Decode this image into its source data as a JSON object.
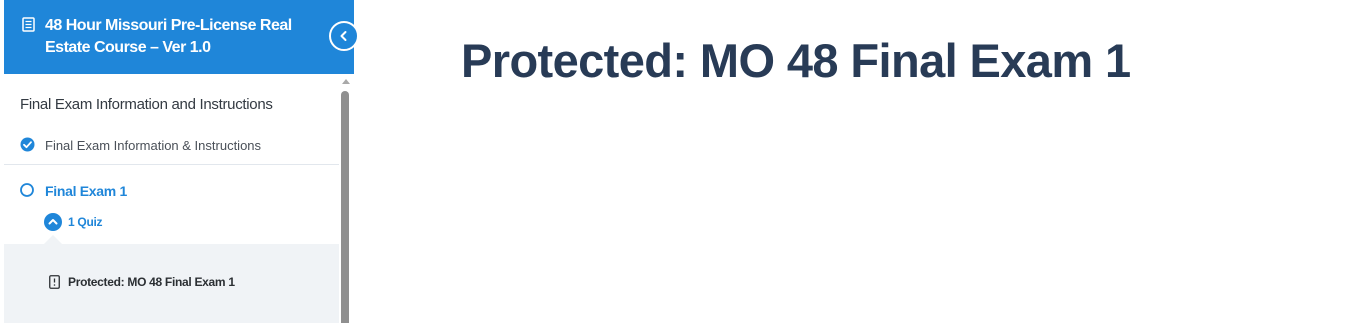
{
  "sidebar": {
    "course_title": "48 Hour Missouri Pre-License Real Estate Course – Ver 1.0",
    "collapse_icon": "chevron-left-icon",
    "section_title": "Final Exam Information and Instructions",
    "lessons": [
      {
        "label": "Final Exam Information & Instructions",
        "status": "completed",
        "icon": "check-circle-icon"
      },
      {
        "label": "Final Exam 1",
        "status": "not-started",
        "icon": "circle-outline-icon",
        "active": true
      }
    ],
    "quiz_toggle": {
      "label": "1 Quiz",
      "icon": "chevron-up-icon",
      "expanded": true
    },
    "quizzes": [
      {
        "label": "Protected: MO 48 Final Exam 1",
        "icon": "quiz-document-icon"
      }
    ]
  },
  "main": {
    "title": "Protected: MO 48 Final Exam 1"
  },
  "colors": {
    "accent": "#1f86d9",
    "title": "#283b56",
    "panel_bg": "#f0f3f6"
  }
}
